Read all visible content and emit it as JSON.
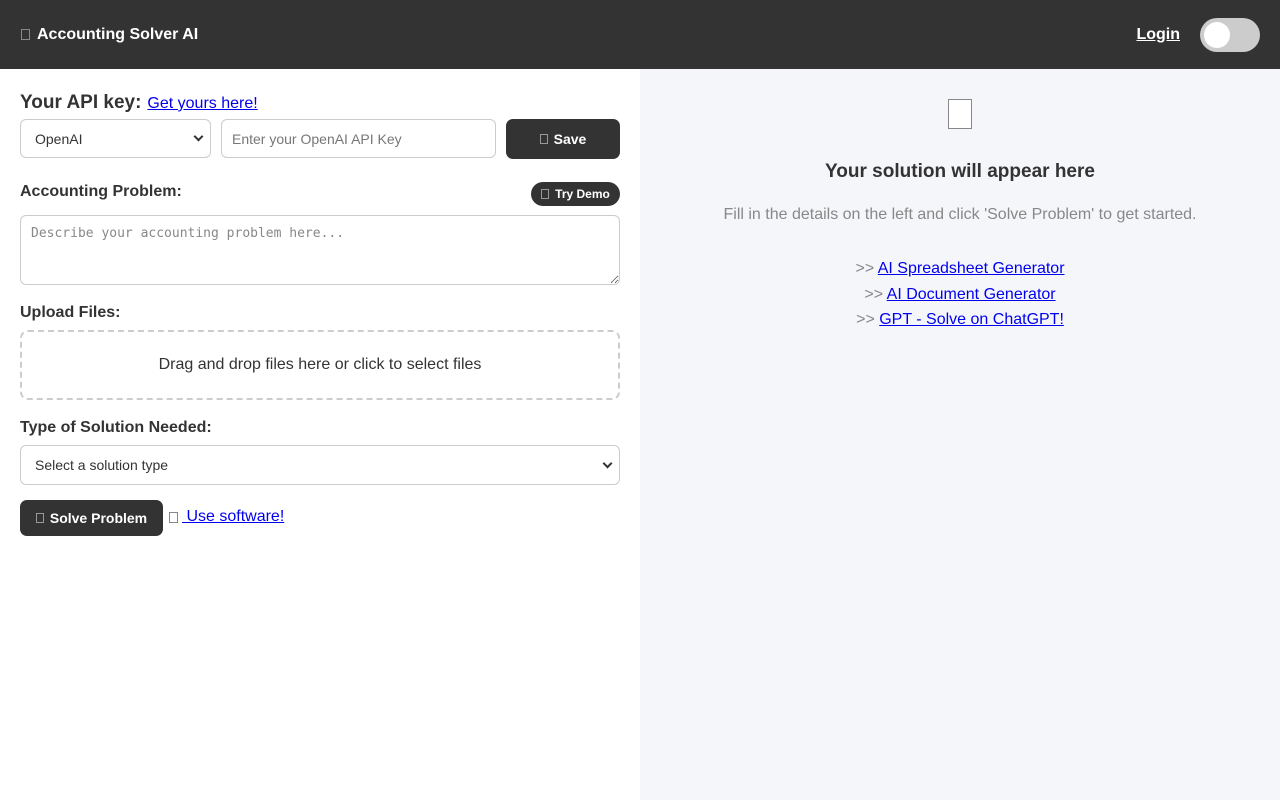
{
  "header": {
    "title": "Accounting Solver AI",
    "login_label": "Login",
    "toggle_state": "off"
  },
  "api": {
    "label": "Your API key:",
    "get_key_link": "Get yours here!",
    "provider_selected": "OpenAI",
    "input_placeholder": "Enter your OpenAI API Key",
    "save_label": "Save"
  },
  "problem": {
    "label": "Accounting Problem:",
    "demo_label": "Try Demo",
    "placeholder": "Describe your accounting problem here..."
  },
  "upload": {
    "label": "Upload Files:",
    "dropzone_text": "Drag and drop files here or click to select files"
  },
  "solution_type": {
    "label": "Type of Solution Needed:",
    "selected": "Select a solution type"
  },
  "actions": {
    "solve_label": "Solve Problem",
    "use_software_label": " Use software!"
  },
  "output": {
    "title": "Your solution will appear here",
    "subtitle": "Fill in the details on the left and click 'Solve Problem' to get started.",
    "link_prefix": ">> ",
    "links": [
      "AI Spreadsheet Generator",
      "AI Document Generator",
      "GPT - Solve on ChatGPT!"
    ]
  },
  "colors": {
    "header_bg": "#333333",
    "panel_right_bg": "#f5f6fa",
    "link": "#0000ee"
  }
}
